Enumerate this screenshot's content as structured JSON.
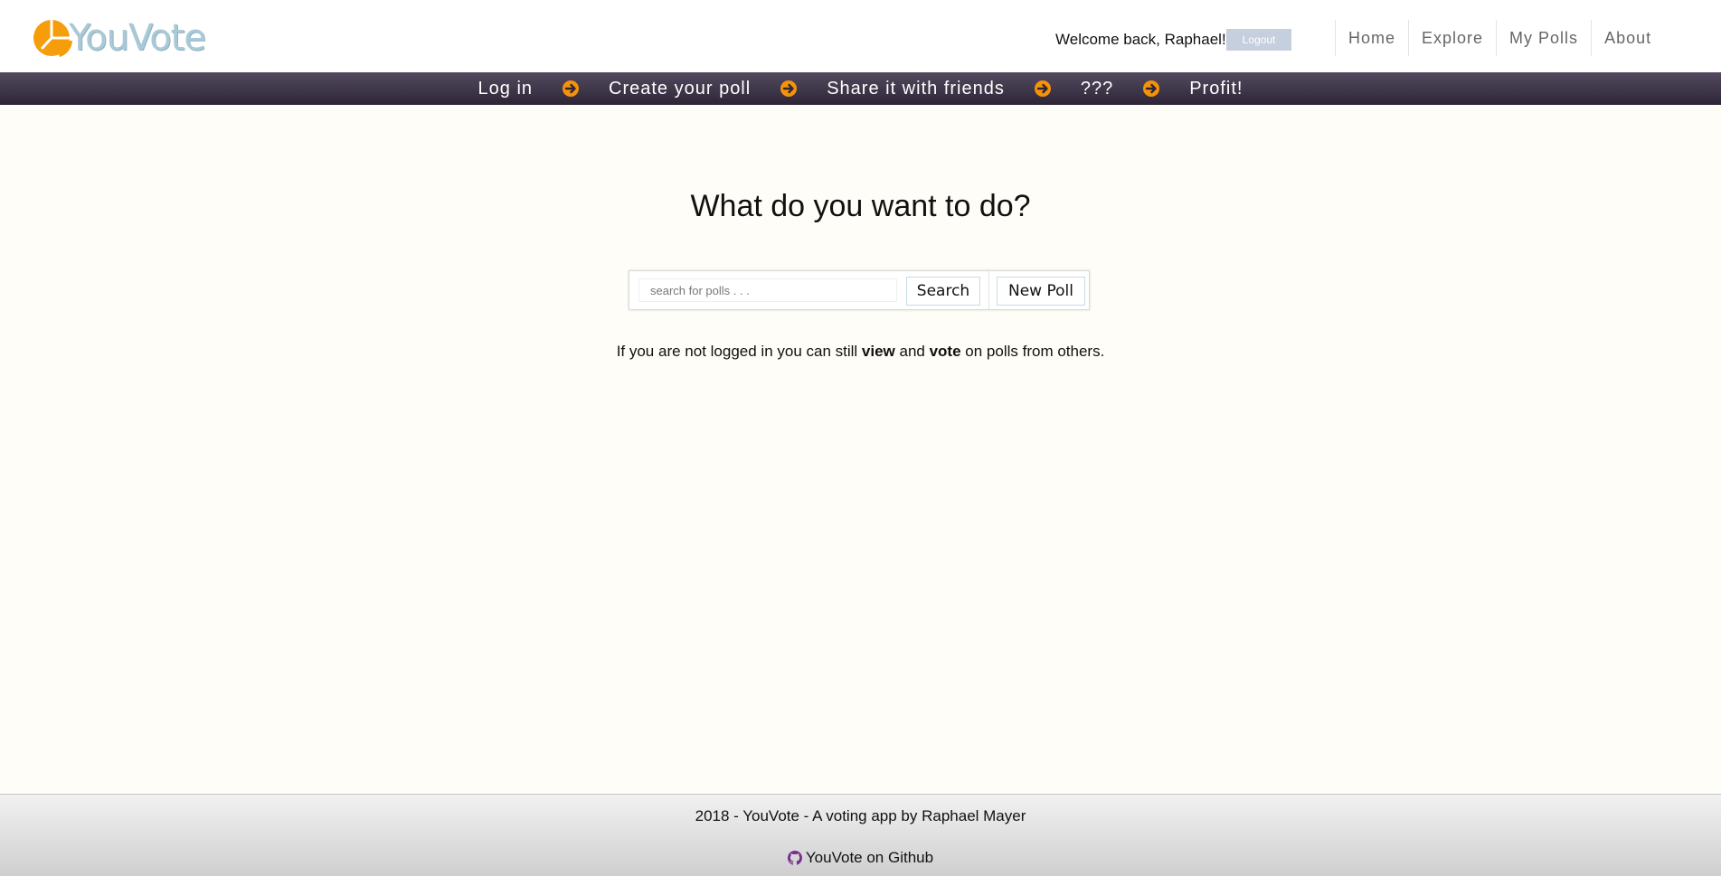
{
  "brand": {
    "name": "YouVote",
    "icon": "pie-chart-logo-icon",
    "logo_color": "#f59d0a",
    "text_color": "#a9c9d6"
  },
  "header": {
    "welcome_text": "Welcome back, Raphael!",
    "logout_label": "Logout",
    "nav": [
      {
        "label": "Home"
      },
      {
        "label": "Explore"
      },
      {
        "label": "My Polls"
      },
      {
        "label": "About"
      }
    ]
  },
  "steps": {
    "items": [
      "Log in",
      "Create your poll",
      "Share it with friends",
      "???",
      "Profit!"
    ],
    "arrow_icon": "arrow-circle-right-icon",
    "arrow_color": "#f5920a",
    "bar_color": "#3e3549"
  },
  "main": {
    "title": "What do you want to do?",
    "search_placeholder": "search for polls . . .",
    "search_value": "",
    "search_label": "Search",
    "new_poll_label": "New Poll",
    "hint_pre": "If you are not logged in you can still ",
    "hint_view": "view",
    "hint_mid": " and ",
    "hint_vote": "vote",
    "hint_post": " on polls from others."
  },
  "footer": {
    "credit": "2018 - YouVote - A voting app by Raphael Mayer",
    "github_icon": "github-icon",
    "github_label": "YouVote on Github",
    "github_color": "#7a2d8f"
  }
}
